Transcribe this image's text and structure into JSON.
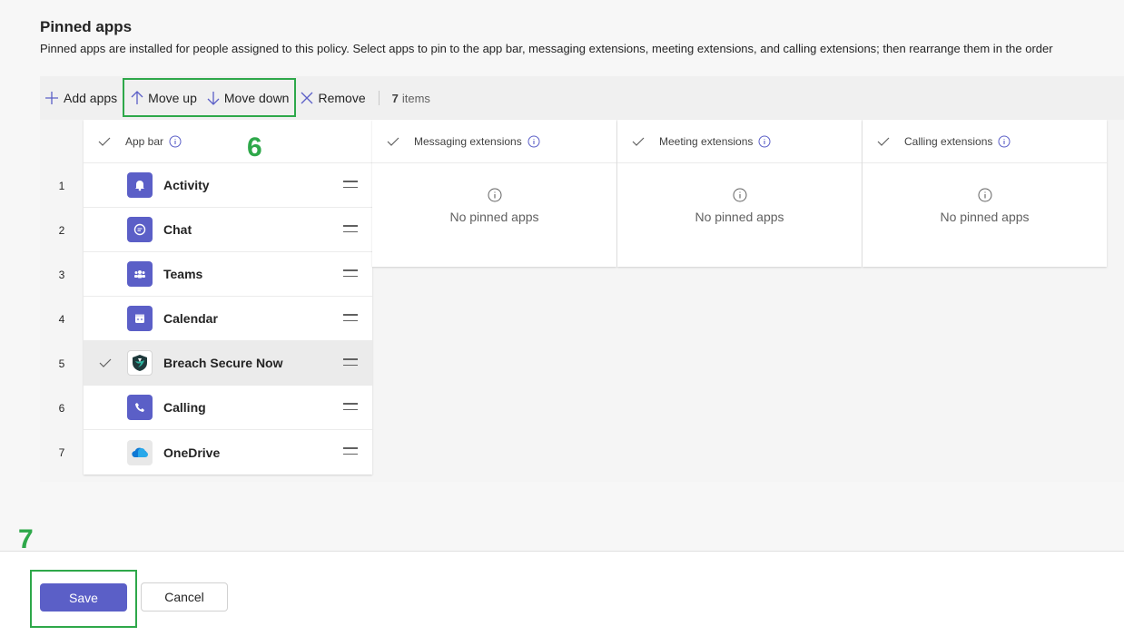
{
  "page": {
    "title": "Pinned apps",
    "description": "Pinned apps are installed for people assigned to this policy. Select apps to pin to the app bar, messaging extensions, meeting extensions, and calling extensions; then rearrange them in the order"
  },
  "toolbar": {
    "add_apps": "Add apps",
    "move_up": "Move up",
    "move_down": "Move down",
    "remove": "Remove",
    "count_number": "7",
    "count_label": "items"
  },
  "columns": {
    "app_bar": "App bar",
    "messaging": "Messaging extensions",
    "meeting": "Meeting extensions",
    "calling": "Calling extensions",
    "empty_text": "No pinned apps"
  },
  "apps": [
    {
      "num": "1",
      "name": "Activity",
      "icon": "bell-icon",
      "selected": false
    },
    {
      "num": "2",
      "name": "Chat",
      "icon": "chat-icon",
      "selected": false
    },
    {
      "num": "3",
      "name": "Teams",
      "icon": "teams-icon",
      "selected": false
    },
    {
      "num": "4",
      "name": "Calendar",
      "icon": "calendar-icon",
      "selected": false
    },
    {
      "num": "5",
      "name": "Breach Secure Now",
      "icon": "shield-logo-icon",
      "selected": true
    },
    {
      "num": "6",
      "name": "Calling",
      "icon": "phone-icon",
      "selected": false
    },
    {
      "num": "7",
      "name": "OneDrive",
      "icon": "cloud-icon",
      "selected": false
    }
  ],
  "annotations": {
    "step_6": "6",
    "step_7": "7"
  },
  "footer": {
    "save": "Save",
    "cancel": "Cancel"
  },
  "colors": {
    "accent": "#5b5fc7",
    "highlight": "#2ea84a"
  }
}
